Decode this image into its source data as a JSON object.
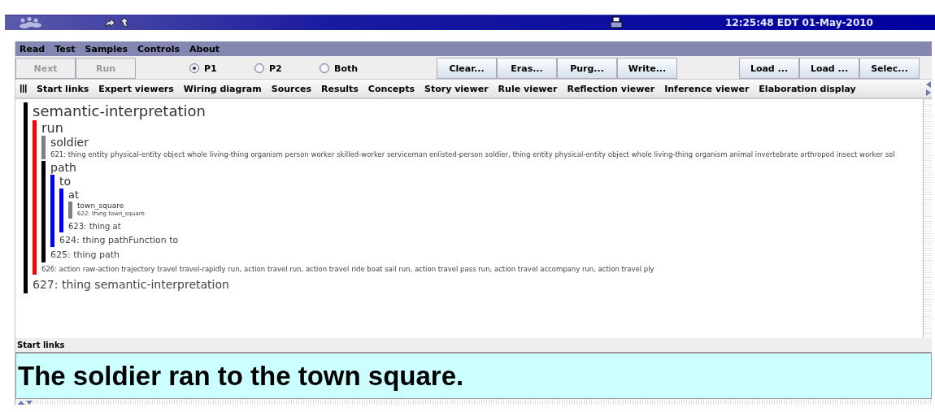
{
  "top_bar": {
    "clock": "12:25:48 EDT 01-May-2010"
  },
  "menu": [
    "Read",
    "Test",
    "Samples",
    "Controls",
    "About"
  ],
  "controls": [
    {
      "kind": "button",
      "label": "Next",
      "disabled": true
    },
    {
      "kind": "button",
      "label": "Run",
      "disabled": true
    },
    {
      "kind": "radio",
      "label": "P1",
      "selected": true
    },
    {
      "kind": "radio",
      "label": "P2",
      "selected": false
    },
    {
      "kind": "radio",
      "label": "Both",
      "selected": false
    },
    {
      "kind": "button",
      "label": "Clear...",
      "disabled": false
    },
    {
      "kind": "button",
      "label": "Eras...",
      "disabled": false
    },
    {
      "kind": "button",
      "label": "Purg...",
      "disabled": false
    },
    {
      "kind": "button",
      "label": "Write...",
      "disabled": false
    },
    {
      "kind": "spacer"
    },
    {
      "kind": "button",
      "label": "Load ...",
      "disabled": false
    },
    {
      "kind": "button",
      "label": "Load ...",
      "disabled": false
    },
    {
      "kind": "button",
      "label": "Selec...",
      "disabled": false
    }
  ],
  "tabs": [
    "Start links",
    "Expert viewers",
    "Wiring diagram",
    "Sources",
    "Results",
    "Concepts",
    "Story viewer",
    "Rule viewer",
    "Reflection viewer",
    "Inference viewer",
    "Elaboration display"
  ],
  "tree": {
    "label": "semantic-interpretation",
    "color": "#000000",
    "footer": "627: thing semantic-interpretation",
    "children": [
      {
        "label": "run",
        "color": "#ff0000",
        "footer": "626: action raw-action trajectory travel travel-rapidly run, action travel run, action travel ride boat sail run, action travel pass run, action travel accompany run, action travel ply",
        "children": [
          {
            "label": "soldier",
            "color": "#808080",
            "footer": "621: thing entity physical-entity object whole living-thing organism person worker skilled-worker serviceman enlisted-person soldier, thing entity physical-entity object whole living-thing organism animal invertebrate arthropod insect worker sol"
          },
          {
            "label": "path",
            "color": "#000000",
            "footer": "625: thing path",
            "children": [
              {
                "label": "to",
                "color": "#0000ff",
                "footer": "624: thing pathFunction to",
                "children": [
                  {
                    "label": "at",
                    "color": "#0000ff",
                    "footer": "623: thing at",
                    "children": [
                      {
                        "label": "town_square",
                        "color": "#808080",
                        "footer": "622: thing town_square"
                      }
                    ]
                  }
                ]
              }
            ]
          }
        ]
      }
    ]
  },
  "panel_label": "Start links",
  "sentence": {
    "value": "The soldier ran to the town square."
  }
}
